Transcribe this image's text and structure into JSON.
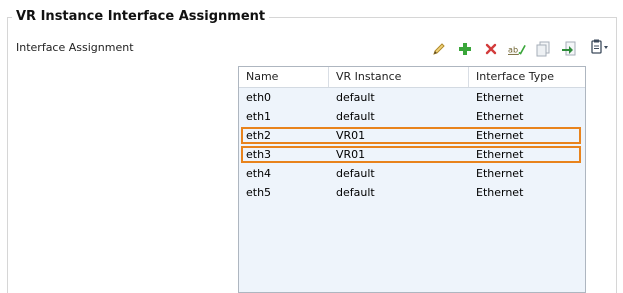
{
  "group": {
    "title": "VR Instance Interface Assignment"
  },
  "section": {
    "label": "Interface Assignment"
  },
  "toolbar": {
    "buttons": [
      {
        "name": "edit-icon",
        "color": "#c89a2c"
      },
      {
        "name": "add-icon",
        "color": "#3aa63a"
      },
      {
        "name": "delete-icon",
        "color": "#d23b3b"
      },
      {
        "name": "rename-icon",
        "color": "#8c7a2a"
      },
      {
        "name": "copy-icon",
        "color": "#9aa3ad"
      },
      {
        "name": "import-icon",
        "color": "#2e8c3a"
      }
    ],
    "side_menu_icon": "clipboard-menu-icon"
  },
  "table": {
    "columns": [
      "Name",
      "VR Instance",
      "Interface Type"
    ],
    "rows": [
      {
        "name": "eth0",
        "vr": "default",
        "type": "Ethernet",
        "highlighted": false
      },
      {
        "name": "eth1",
        "vr": "default",
        "type": "Ethernet",
        "highlighted": false
      },
      {
        "name": "eth2",
        "vr": "VR01",
        "type": "Ethernet",
        "highlighted": true
      },
      {
        "name": "eth3",
        "vr": "VR01",
        "type": "Ethernet",
        "highlighted": true
      },
      {
        "name": "eth4",
        "vr": "default",
        "type": "Ethernet",
        "highlighted": false
      },
      {
        "name": "eth5",
        "vr": "default",
        "type": "Ethernet",
        "highlighted": false
      }
    ],
    "highlight_color": "#e8831c"
  }
}
